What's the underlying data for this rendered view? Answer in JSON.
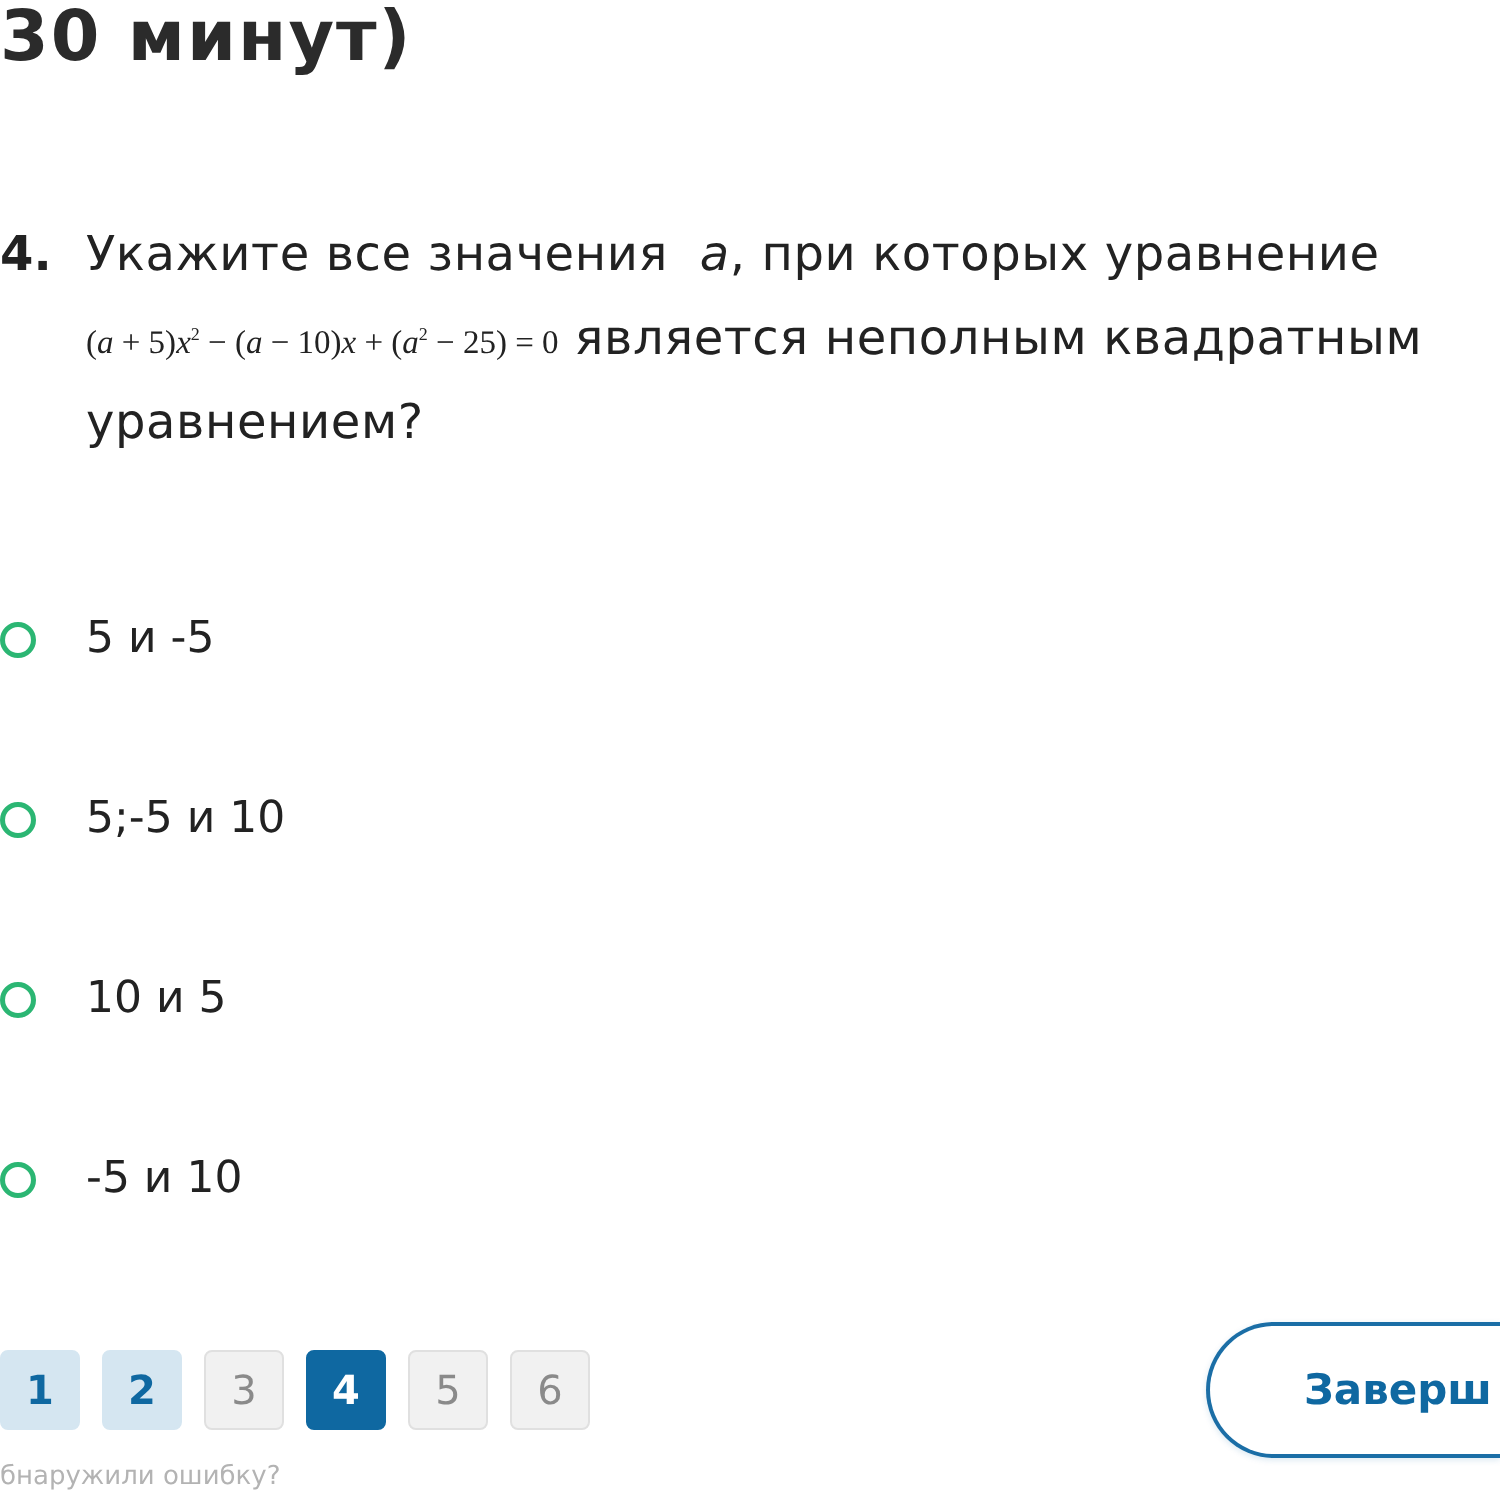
{
  "title": "30 минут)",
  "question": {
    "number": "4.",
    "text": "Укажите все значения  *a*, при которых уравнение",
    "formula": "(*a* + 5)*x*$^{2}$ − (*a* − 10)*x* + (*a*$^{2}$ − 25) = 0",
    "text_after": [
      "является неполным квадратным",
      "уравнением?"
    ]
  },
  "options": [
    {
      "label": "5 и -5",
      "selected": false
    },
    {
      "label": "5;-5 и 10",
      "selected": false
    },
    {
      "label": "10 и 5",
      "selected": false
    },
    {
      "label": "-5 и 10",
      "selected": false
    }
  ],
  "pagination": [
    {
      "label": "1",
      "answered": true,
      "selected": false
    },
    {
      "label": "2",
      "answered": true,
      "selected": false
    },
    {
      "label": "3",
      "answered": false,
      "selected": false
    },
    {
      "label": "4",
      "answered": false,
      "selected": true
    },
    {
      "label": "5",
      "answered": false,
      "selected": false
    },
    {
      "label": "6",
      "answered": false,
      "selected": false
    }
  ],
  "finish_button": "Заверш",
  "report_link": "бнаружили ошибку?"
}
